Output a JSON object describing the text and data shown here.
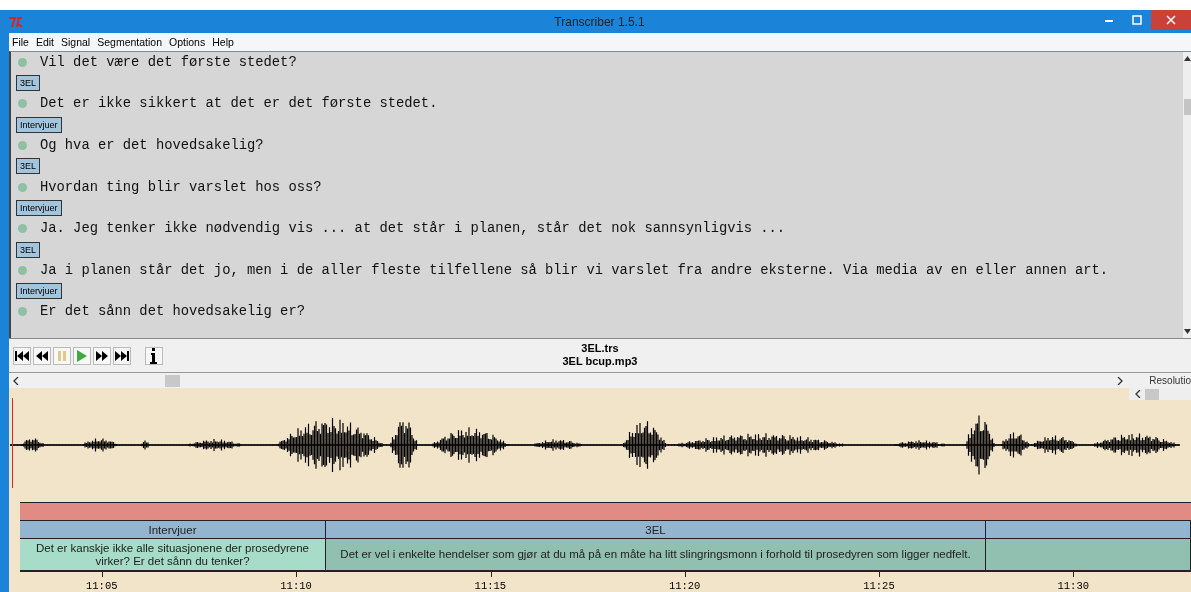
{
  "window": {
    "title": "Transcriber 1.5.1"
  },
  "menu": [
    "File",
    "Edit",
    "Signal",
    "Segmentation",
    "Options",
    "Help"
  ],
  "transcript": [
    {
      "kind": "text",
      "text": "Vil det være det første stedet?"
    },
    {
      "kind": "speaker",
      "text": "3EL"
    },
    {
      "kind": "text",
      "text": "Det er ikke sikkert at det er det første stedet."
    },
    {
      "kind": "speaker",
      "text": "Intervjuer"
    },
    {
      "kind": "text",
      "text": "Og hva er det hovedsakelig?"
    },
    {
      "kind": "speaker",
      "text": "3EL"
    },
    {
      "kind": "text",
      "text": "Hvordan ting blir varslet hos oss?"
    },
    {
      "kind": "speaker",
      "text": "Intervjuer"
    },
    {
      "kind": "text",
      "text": "Ja. Jeg tenker ikke nødvendig vis ... at det står i planen, står det nok sannsynligvis ..."
    },
    {
      "kind": "speaker",
      "text": "3EL"
    },
    {
      "kind": "text",
      "text": "Ja i planen står det jo, men i de aller fleste tilfellene så blir vi varslet fra andre eksterne. Via media av en eller annen art."
    },
    {
      "kind": "speaker",
      "text": "Intervjuer"
    },
    {
      "kind": "text",
      "text": "Er det sånn det hovedsakelig er?"
    }
  ],
  "player": {
    "paused_disabled": true,
    "files": [
      "3EL.trs",
      "3EL bcup.mp3"
    ]
  },
  "resolution_label": "Resolutio",
  "speaker_segments": [
    {
      "kind": "segment",
      "label": "Intervjuer"
    },
    {
      "kind": "segment",
      "label": "3EL"
    },
    {
      "kind": "gap"
    }
  ],
  "text_segments": [
    {
      "kind": "segment",
      "selected": true,
      "text": "Det er kanskje ikke alle situasjonene der prosedyrene virker? Er det sånn du tenker?"
    },
    {
      "kind": "segment",
      "selected": false,
      "text": "Det er vel i enkelte hendelser som gjør at du må på en måte ha litt slingringsmonn i forhold til prosedyren som ligger nedfelt."
    },
    {
      "kind": "gap",
      "selected": false
    }
  ],
  "timeline": [
    "11:05",
    "11:10",
    "11:15",
    "11:20",
    "11:25",
    "11:30"
  ]
}
